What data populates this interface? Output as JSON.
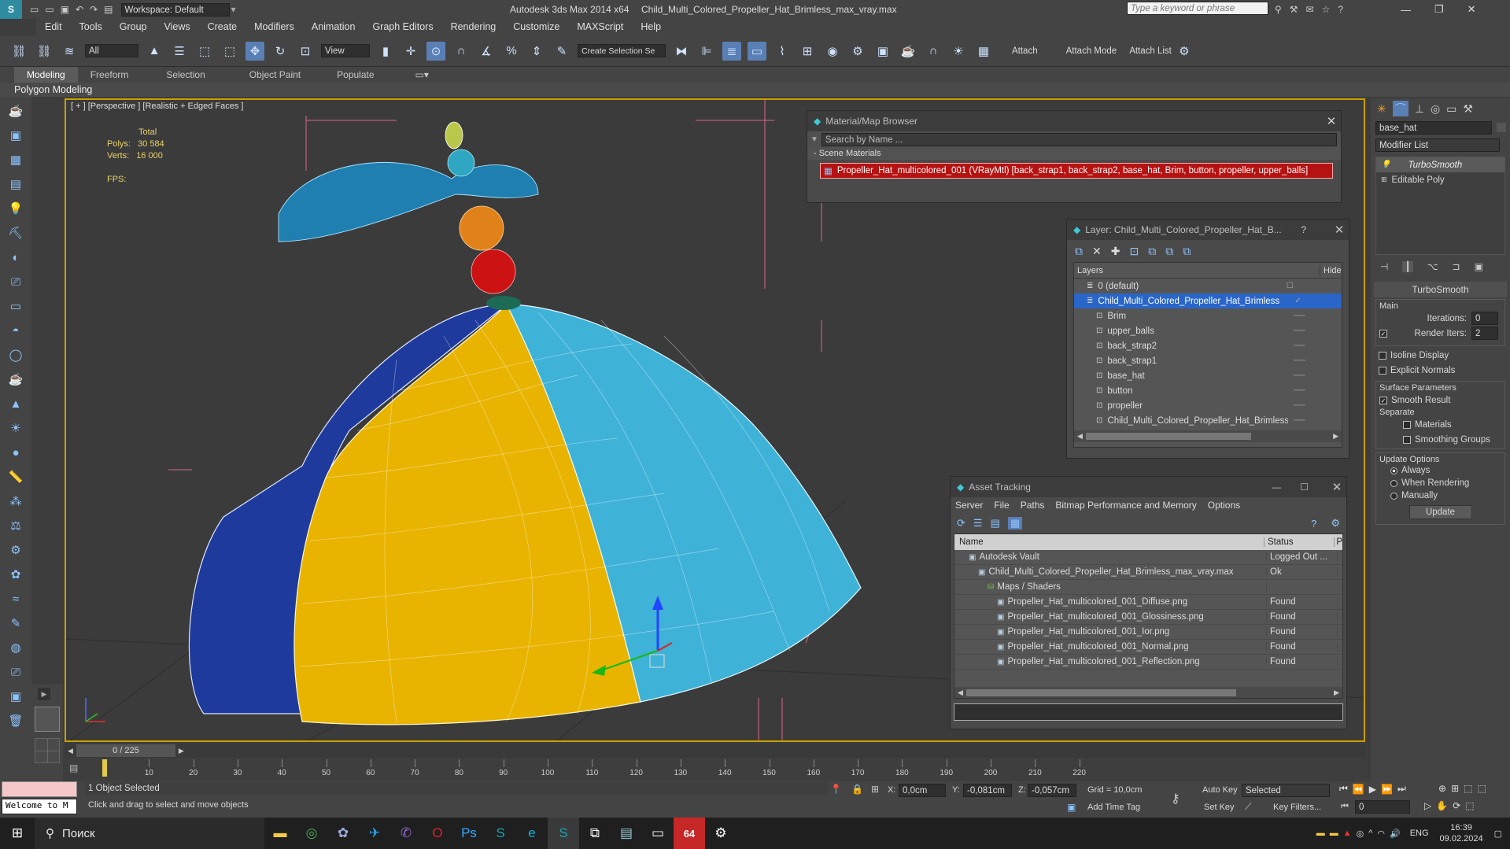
{
  "title": {
    "workspace": "Workspace: Default",
    "app": "Autodesk 3ds Max  2014 x64",
    "file": "Child_Multi_Colored_Propeller_Hat_Brimless_max_vray.max",
    "search_placeholder": "Type a keyword or phrase"
  },
  "menu": [
    "Edit",
    "Tools",
    "Group",
    "Views",
    "Create",
    "Modifiers",
    "Animation",
    "Graph Editors",
    "Rendering",
    "Customize",
    "MAXScript",
    "Help"
  ],
  "toolbar": {
    "filter": "All",
    "ref_coord": "View",
    "selection_set": "Create Selection Se",
    "attach": "Attach",
    "attach_mode": "Attach Mode",
    "attach_list": "Attach List"
  },
  "ribbon": {
    "tabs": [
      "Modeling",
      "Freeform",
      "Selection",
      "Object Paint",
      "Populate"
    ],
    "sub": "Polygon Modeling"
  },
  "viewport": {
    "label": "[ + ] [Perspective ] [Realistic + Edged Faces ]",
    "stats_total": "Total",
    "polys_label": "Polys:",
    "polys": "30 584",
    "verts_label": "Verts:",
    "verts": "16 000",
    "fps": "FPS:"
  },
  "material_browser": {
    "title": "Material/Map Browser",
    "search": "Search by Name ...",
    "section": "- Scene Materials",
    "item": "Propeller_Hat_multicolored_001 (VRayMtl) [back_strap1, back_strap2, base_hat, Brim, button, propeller, upper_balls]"
  },
  "layer_panel": {
    "title": "Layer: Child_Multi_Colored_Propeller_Hat_B...",
    "help": "?",
    "col_layers": "Layers",
    "col_hide": "Hide",
    "rows": [
      {
        "name": "0 (default)",
        "indent": 0,
        "selected": false
      },
      {
        "name": "Child_Multi_Colored_Propeller_Hat_Brimless",
        "indent": 0,
        "selected": true
      },
      {
        "name": "Brim",
        "indent": 1,
        "selected": false
      },
      {
        "name": "upper_balls",
        "indent": 1,
        "selected": false
      },
      {
        "name": "back_strap2",
        "indent": 1,
        "selected": false
      },
      {
        "name": "back_strap1",
        "indent": 1,
        "selected": false
      },
      {
        "name": "base_hat",
        "indent": 1,
        "selected": false
      },
      {
        "name": "button",
        "indent": 1,
        "selected": false
      },
      {
        "name": "propeller",
        "indent": 1,
        "selected": false
      },
      {
        "name": "Child_Multi_Colored_Propeller_Hat_Brimless",
        "indent": 1,
        "selected": false
      }
    ]
  },
  "asset_tracking": {
    "title": "Asset Tracking",
    "menu": [
      "Server",
      "File",
      "Paths",
      "Bitmap Performance and Memory",
      "Options"
    ],
    "col_name": "Name",
    "col_status": "Status",
    "col_p": "P",
    "rows": [
      {
        "name": "Autodesk Vault",
        "status": "Logged Out ...",
        "indent": 1
      },
      {
        "name": "Child_Multi_Colored_Propeller_Hat_Brimless_max_vray.max",
        "status": "Ok",
        "indent": 2
      },
      {
        "name": "Maps / Shaders",
        "status": "",
        "indent": 3
      },
      {
        "name": "Propeller_Hat_multicolored_001_Diffuse.png",
        "status": "Found",
        "indent": 4
      },
      {
        "name": "Propeller_Hat_multicolored_001_Glossiness.png",
        "status": "Found",
        "indent": 4
      },
      {
        "name": "Propeller_Hat_multicolored_001_Ior.png",
        "status": "Found",
        "indent": 4
      },
      {
        "name": "Propeller_Hat_multicolored_001_Normal.png",
        "status": "Found",
        "indent": 4
      },
      {
        "name": "Propeller_Hat_multicolored_001_Reflection.png",
        "status": "Found",
        "indent": 4
      }
    ]
  },
  "command_panel": {
    "object_name": "base_hat",
    "modifier_list": "Modifier List",
    "stack": [
      "TurboSmooth",
      "Editable Poly"
    ],
    "rollout": "TurboSmooth",
    "main": "Main",
    "iterations_label": "Iterations:",
    "iterations": "0",
    "render_iters_label": "Render Iters:",
    "render_iters": "2",
    "isoline": "Isoline Display",
    "explicit_normals": "Explicit Normals",
    "surface_params": "Surface Parameters",
    "smooth_result": "Smooth Result",
    "separate": "Separate",
    "materials": "Materials",
    "smoothing_groups": "Smoothing Groups",
    "update_options": "Update Options",
    "always": "Always",
    "when_rendering": "When Rendering",
    "manually": "Manually",
    "update": "Update"
  },
  "timeline": {
    "frame": "0 / 225",
    "ticks": [
      "0",
      "10",
      "20",
      "30",
      "40",
      "50",
      "60",
      "70",
      "80",
      "90",
      "100",
      "110",
      "120",
      "130",
      "140",
      "150",
      "160",
      "170",
      "180",
      "190",
      "200",
      "210",
      "220"
    ]
  },
  "status": {
    "selected": "1 Object Selected",
    "prompt": "Click and drag to select and move objects",
    "welcome": "Welcome to M",
    "x_label": "X:",
    "x": "0,0cm",
    "y_label": "Y:",
    "y": "-0,081cm",
    "z_label": "Z:",
    "z": "-0,057cm",
    "grid": "Grid = 10,0cm",
    "add_time_tag": "Add Time Tag",
    "auto_key": "Auto Key",
    "set_key": "Set Key",
    "selected_mode": "Selected",
    "key_filters": "Key Filters...",
    "frame_field": "0"
  },
  "taskbar": {
    "search": "Поиск",
    "lang": "ENG",
    "time": "16:39",
    "date": "09.02.2024"
  },
  "colors": {
    "selection_border": "#c8a000",
    "selected_row": "#2a66c8",
    "hat_yellow": "#e8b400",
    "hat_blue": "#1e3a9c",
    "hat_cyan": "#3fb2d8",
    "ball_orange": "#e0811a",
    "ball_red": "#cc1212"
  }
}
